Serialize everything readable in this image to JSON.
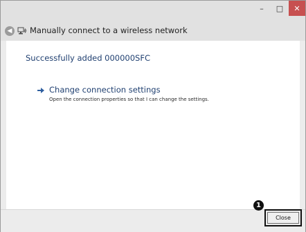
{
  "window": {
    "caption": {
      "minimize": "–",
      "maximize": "□",
      "close": "✕"
    },
    "nav_title": "Manually connect to a wireless network"
  },
  "content": {
    "status": "Successfully added 000000SFC",
    "option": {
      "title": "Change connection settings",
      "description": "Open the connection properties so that I can change the settings."
    }
  },
  "footer": {
    "marker": "1",
    "close_label": "Close"
  }
}
